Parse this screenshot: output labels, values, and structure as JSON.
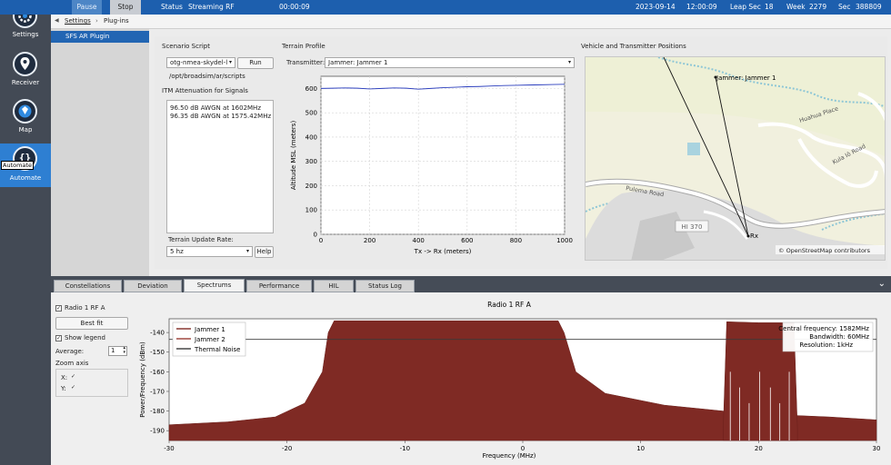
{
  "topbar": {
    "pause_label": "Pause",
    "stop_label": "Stop",
    "status_label": "Status",
    "status_value": "Streaming RF",
    "elapsed": "00:00:09",
    "date": "2023-09-14",
    "time": "12:00:09",
    "leap_sec_label": "Leap Sec",
    "leap_sec_value": "18",
    "week_label": "Week",
    "week_value": "2279",
    "sec_label": "Sec",
    "sec_value": "388809"
  },
  "sidebar": {
    "items": [
      {
        "label": "Settings",
        "icon": "gear-icon"
      },
      {
        "label": "Receiver",
        "icon": "location-pin-icon"
      },
      {
        "label": "Map",
        "icon": "map-icon"
      },
      {
        "label": "Automate",
        "icon": "braces-icon"
      }
    ],
    "tooltip": "Automate"
  },
  "breadcrumb": {
    "root": "Settings",
    "separator": "›",
    "current": "Plug-ins"
  },
  "plugins": {
    "items": [
      "SFS AR Plugin"
    ]
  },
  "scenario": {
    "title": "Scenario Script",
    "script_value": "otg-nmea-skydel-l",
    "run_label": "Run",
    "path": "/opt/broadsim/ar/scripts"
  },
  "itm": {
    "title": "ITM Attenuation for Signals",
    "lines": [
      "96.50 dB AWGN at 1602MHz",
      "96.35 dB AWGN at 1575.42MHz"
    ]
  },
  "terrain_update": {
    "label": "Terrain Update Rate:",
    "value": "5 hz",
    "help_label": "Help"
  },
  "terrain_profile": {
    "title": "Terrain Profile",
    "transmitter_label": "Transmitter:",
    "transmitter_value": "Jammer: Jammer 1"
  },
  "map": {
    "title": "Vehicle and Transmitter Positions",
    "jammer_label": "Jammer: Jammer 1",
    "rx_label": "Rx",
    "road_labels": [
      "Pulema Road",
      "Huahua Place",
      "Kula Iō Road",
      "HI 370"
    ],
    "attribution": "© OpenStreetMap contributors"
  },
  "tabs": {
    "items": [
      "Constellations",
      "Deviation",
      "Spectrums",
      "Performance",
      "HIL",
      "Status Log"
    ],
    "active": "Spectrums"
  },
  "spectrum_controls": {
    "radio_label": "Radio 1 RF A",
    "best_fit_label": "Best fit",
    "show_legend_label": "Show legend",
    "average_label": "Average:",
    "average_value": "1",
    "zoom_label": "Zoom axis",
    "x_label": "X:",
    "y_label": "Y:"
  },
  "spectrum_info": {
    "central": "Central frequency: 1582MHz",
    "bandwidth": "Bandwidth: 60MHz",
    "resolution": "Resolution: 1kHz"
  },
  "colors": {
    "accent": "#1d5fae",
    "sidebar": "#434a55",
    "spectrum": "#7f2a24",
    "terrain_line": "#2a3dbd"
  },
  "chart_data": [
    {
      "type": "line",
      "title": "",
      "xlabel": "Tx -> Rx (meters)",
      "ylabel": "Altitude MSL (meters)",
      "xlim": [
        0,
        1000
      ],
      "ylim": [
        0,
        650
      ],
      "xticks": [
        0,
        200,
        400,
        600,
        800,
        1000
      ],
      "yticks": [
        0,
        100,
        200,
        300,
        400,
        500,
        600
      ],
      "x": [
        0,
        50,
        100,
        150,
        200,
        250,
        300,
        350,
        400,
        450,
        500,
        550,
        600,
        650,
        700,
        750,
        800,
        850,
        900,
        950,
        1000
      ],
      "y": [
        600,
        601,
        602,
        601,
        598,
        600,
        602,
        601,
        597,
        600,
        603,
        605,
        607,
        608,
        610,
        612,
        613,
        614,
        615,
        616,
        617
      ]
    },
    {
      "type": "area",
      "title": "Radio 1 RF A",
      "xlabel": "Frequency (MHz)",
      "ylabel": "Power/Frequency (dBm)",
      "xlim": [
        -30,
        30
      ],
      "ylim": [
        -195,
        -133
      ],
      "xticks": [
        -30,
        -20,
        -10,
        0,
        10,
        20,
        30
      ],
      "yticks": [
        -140,
        -150,
        -160,
        -170,
        -180,
        -190
      ],
      "legend": [
        "Jammer 1",
        "Jammer 2",
        "Thermal Noise"
      ],
      "legend_position": "top-left",
      "series": [
        {
          "name": "Jammer 1",
          "x": [
            -30,
            -25,
            -21,
            -18.5,
            -17,
            -16.5,
            -16,
            3,
            3.5,
            4.5,
            7,
            12,
            17,
            22,
            26,
            30
          ],
          "y": [
            -187,
            -185.5,
            -183,
            -176,
            -160,
            -140,
            -134,
            -134,
            -140,
            -160,
            -171,
            -177,
            -180,
            -182,
            -183,
            -184.5
          ]
        },
        {
          "name": "Jammer 2",
          "x": [
            17,
            17.3,
            20,
            23,
            23.3
          ],
          "y": [
            -189,
            -134.5,
            -135,
            -135,
            -189
          ]
        },
        {
          "name": "Thermal Noise",
          "x": [
            -30,
            30
          ],
          "y": [
            -143.5,
            -143.5
          ]
        }
      ]
    }
  ]
}
